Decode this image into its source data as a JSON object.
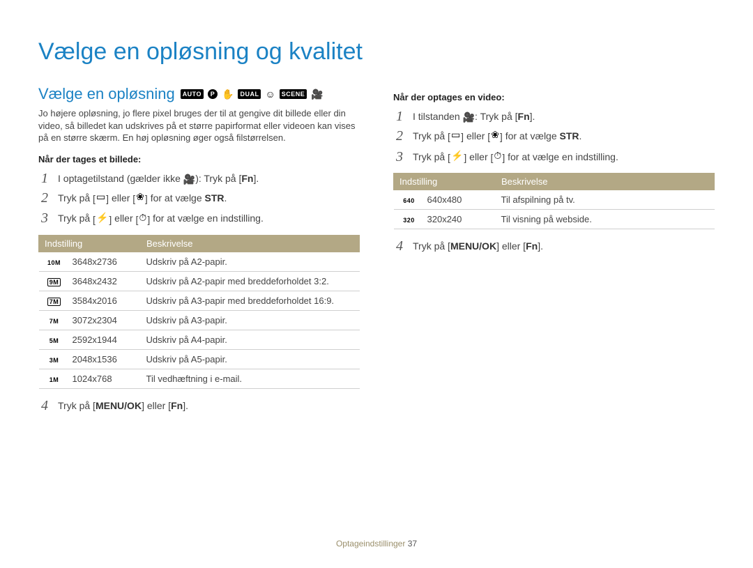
{
  "title": "Vælge en opløsning og kvalitet",
  "section_title": "Vælge en opløsning",
  "mode_icons": [
    "AUTO",
    "P",
    "DUAL",
    "SCENE"
  ],
  "intro": "Jo højere opløsning, jo flere pixel bruges der til at gengive dit billede eller din video, så billedet kan udskrives på et større papirformat eller videoen kan vises på en større skærm. En høj opløsning øger også filstørrelsen.",
  "left": {
    "subhead": "Når der tages et billede:",
    "steps": {
      "s1a": "I optagetilstand (gælder ikke ",
      "s1b": "): Tryk på [",
      "s1c": "].",
      "s2a": "Tryk på ",
      "s2b": " eller ",
      "s2c": " for at vælge ",
      "s2d": ".",
      "s3a": "Tryk på ",
      "s3b": " eller ",
      "s3c": " for at vælge en indstilling.",
      "s4a": "Tryk på [",
      "s4b": "] eller [",
      "s4c": "]."
    },
    "keys": {
      "fn": "Fn",
      "str": "STR",
      "menuok": "MENU/OK"
    },
    "table": {
      "h1": "Indstilling",
      "h2": "Beskrivelse",
      "rows": [
        {
          "label": "10M",
          "boxed": false,
          "dim": "3648x2736",
          "desc": "Udskriv på A2-papir."
        },
        {
          "label": "9M",
          "boxed": true,
          "dim": "3648x2432",
          "desc": "Udskriv på A2-papir med breddeforholdet 3:2."
        },
        {
          "label": "7M",
          "boxed": true,
          "dim": "3584x2016",
          "desc": "Udskriv på A3-papir med breddeforholdet 16:9."
        },
        {
          "label": "7M",
          "boxed": false,
          "dim": "3072x2304",
          "desc": "Udskriv på A3-papir."
        },
        {
          "label": "5M",
          "boxed": false,
          "dim": "2592x1944",
          "desc": "Udskriv på A4-papir."
        },
        {
          "label": "3M",
          "boxed": false,
          "dim": "2048x1536",
          "desc": "Udskriv på A5-papir."
        },
        {
          "label": "1M",
          "boxed": false,
          "dim": "1024x768",
          "desc": "Til vedhæftning i e-mail."
        }
      ]
    }
  },
  "right": {
    "subhead": "Når der optages en video:",
    "steps": {
      "s1a": "I tilstanden ",
      "s1b": ": Tryk på [",
      "s1c": "].",
      "s2a": "Tryk på ",
      "s2b": " eller ",
      "s2c": " for at vælge ",
      "s2d": ".",
      "s3a": "Tryk på ",
      "s3b": " eller ",
      "s3c": " for at vælge en indstilling.",
      "s4a": "Tryk på [",
      "s4b": "] eller [",
      "s4c": "]."
    },
    "keys": {
      "fn": "Fn",
      "str": "STR",
      "menuok": "MENU/OK"
    },
    "table": {
      "h1": "Indstilling",
      "h2": "Beskrivelse",
      "rows": [
        {
          "label": "640",
          "dim": "640x480",
          "desc": "Til afspilning på tv."
        },
        {
          "label": "320",
          "dim": "320x240",
          "desc": "Til visning på webside."
        }
      ]
    }
  },
  "footer": {
    "section": "Optageindstillinger",
    "page": "37"
  }
}
